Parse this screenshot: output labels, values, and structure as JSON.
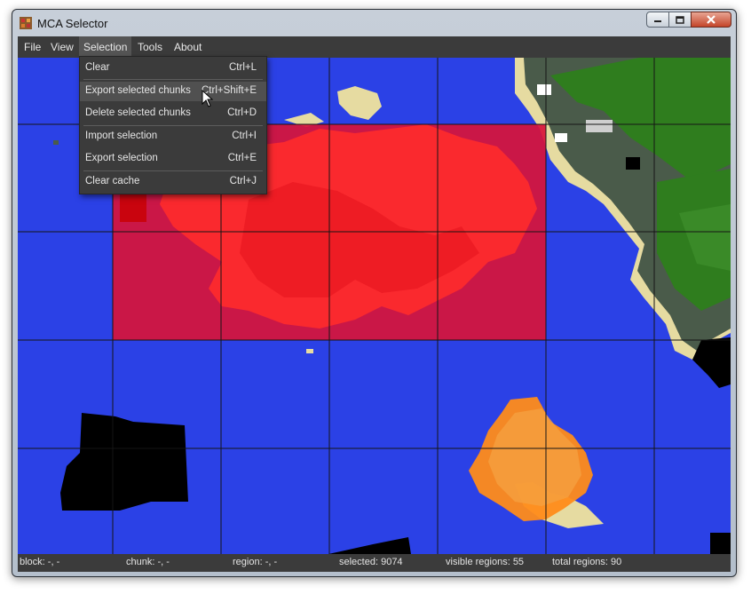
{
  "window": {
    "title": "MCA Selector"
  },
  "menubar": {
    "items": [
      "File",
      "View",
      "Selection",
      "Tools",
      "About"
    ],
    "active": "Selection"
  },
  "selection_menu": {
    "items": [
      {
        "label": "Clear",
        "shortcut": "Ctrl+L"
      },
      {
        "label": "Export selected chunks",
        "shortcut": "Ctrl+Shift+E"
      },
      {
        "label": "Delete selected chunks",
        "shortcut": "Ctrl+D"
      },
      {
        "label": "Import selection",
        "shortcut": "Ctrl+I"
      },
      {
        "label": "Export selection",
        "shortcut": "Ctrl+E"
      },
      {
        "label": "Clear cache",
        "shortcut": "Ctrl+J"
      }
    ],
    "hovered": "Export selected chunks"
  },
  "statusbar": {
    "block": "block: -, -",
    "chunk": "chunk: -, -",
    "region": "region: -, -",
    "selected": "selected: 9074",
    "visible_regions": "visible regions: 55",
    "total_regions": "total regions: 90"
  },
  "colors": {
    "ocean": "#2b41e6",
    "selection_red": "#ff1e1e",
    "selection_orange": "#ff8c1a",
    "grid": "#1a1a1a",
    "menu_bg": "#3b3b3b"
  },
  "icons": [
    "app-icon",
    "minimize-icon",
    "maximize-icon",
    "close-icon",
    "mouse-cursor-icon"
  ]
}
